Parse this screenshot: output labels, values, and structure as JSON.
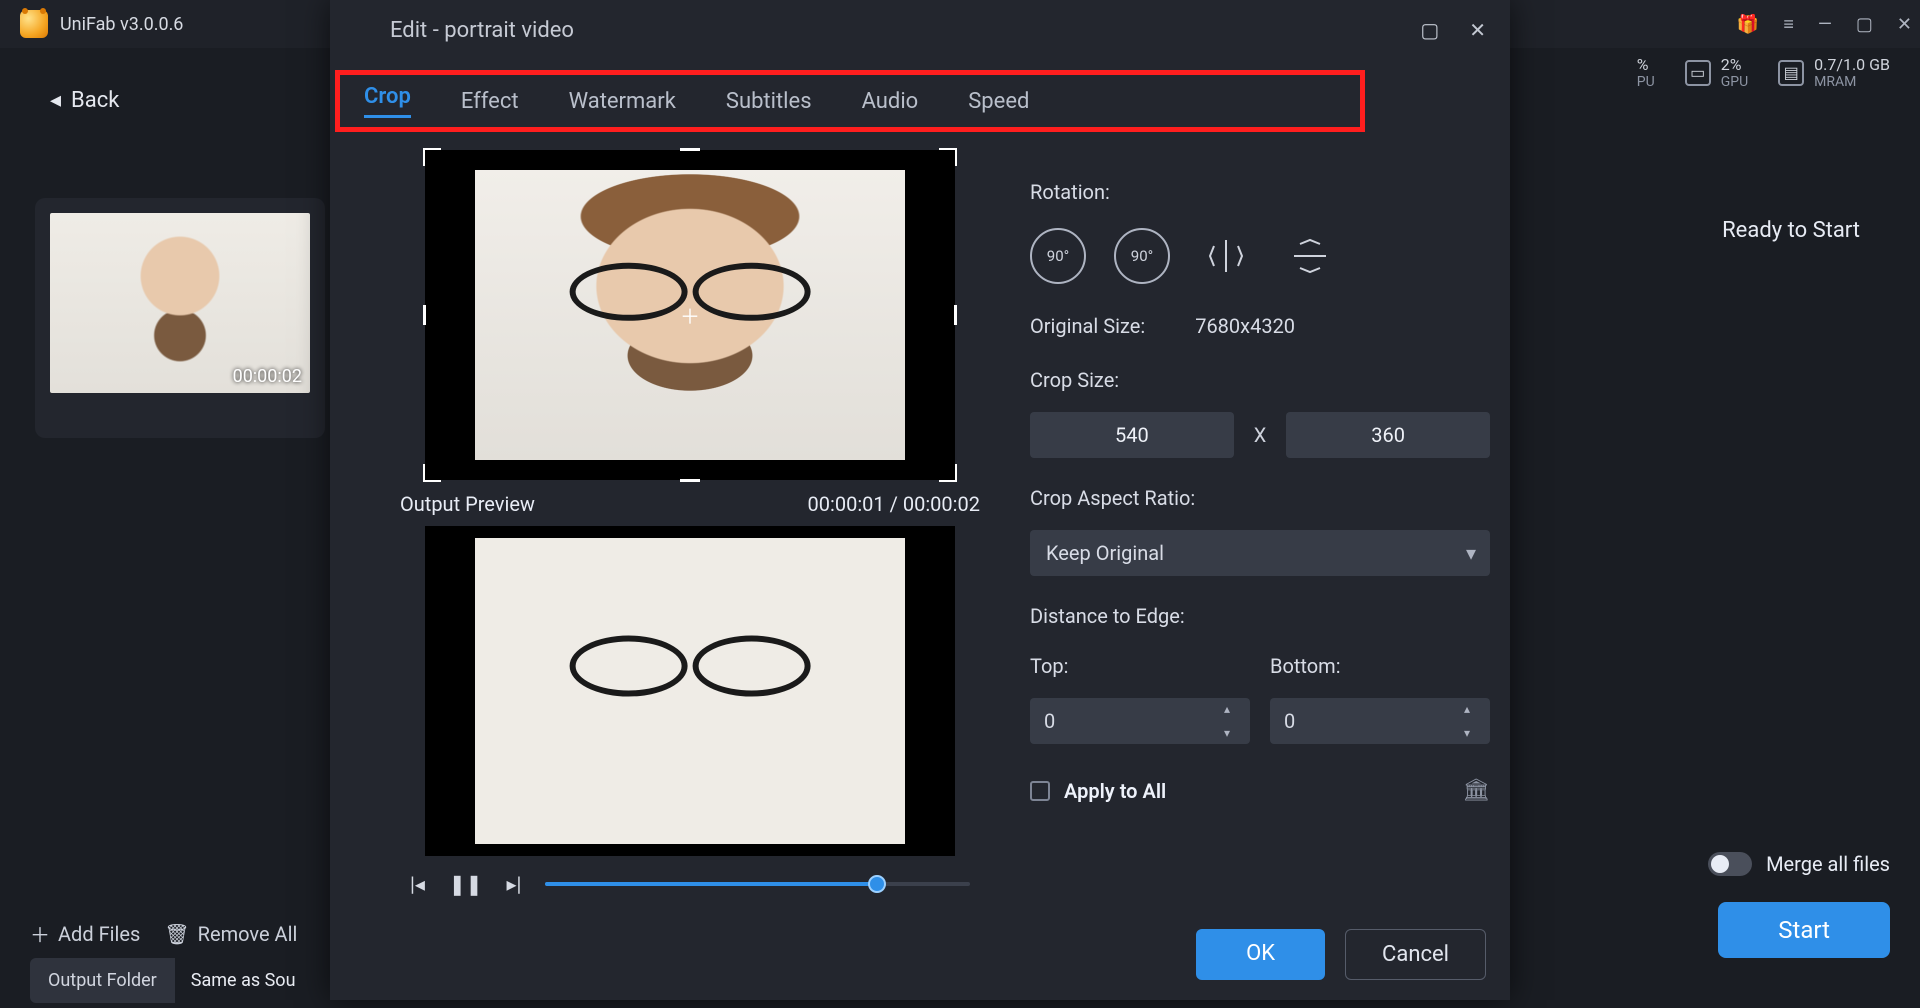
{
  "app": {
    "title": "UniFab v3.0.0.6"
  },
  "titlebar_icons": {
    "gift": "⚙",
    "menu": "≡",
    "min": "—",
    "max": "▢",
    "close": "✕"
  },
  "stats": {
    "cpu_pct": "%",
    "cpu_lab": "PU",
    "gpu_pct": "2%",
    "gpu_lab": "GPU",
    "ram_val": "0.7/1.0 GB",
    "ram_lab": "MRAM"
  },
  "back_label": "Back",
  "thumb_ts": "00:00:02",
  "ready": "Ready to Start",
  "bottom": {
    "add": "Add Files",
    "remove": "Remove All",
    "outfolder": "Output Folder",
    "outpath": "Same as Sou",
    "merge": "Merge all files",
    "start": "Start"
  },
  "modal": {
    "title": "Edit - portrait video",
    "win_max": "▢",
    "win_close": "✕",
    "tabs": {
      "crop": "Crop",
      "effect": "Effect",
      "watermark": "Watermark",
      "subtitles": "Subtitles",
      "audio": "Audio",
      "speed": "Speed"
    },
    "preview_label": "Output Preview",
    "time_cur": "00:00:01",
    "time_tot": "00:00:02",
    "rotation": "Rotation:",
    "rot90a": "90°",
    "rot90b": "90°",
    "orig_label": "Original Size:",
    "orig_val": "7680x4320",
    "crop_label": "Crop Size:",
    "crop_w": "540",
    "x": "X",
    "crop_h": "360",
    "aspect_label": "Crop Aspect Ratio:",
    "aspect_val": "Keep Original",
    "edge_label": "Distance to Edge:",
    "top_label": "Top:",
    "top_val": "0",
    "bot_label": "Bottom:",
    "bot_val": "0",
    "apply": "Apply to All",
    "ok": "OK",
    "cancel": "Cancel"
  }
}
